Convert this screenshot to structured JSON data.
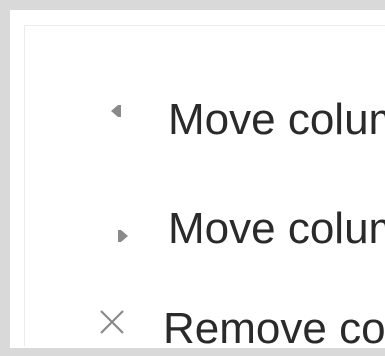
{
  "menu": {
    "items": [
      {
        "label": "Move colum",
        "icon": "move-left-icon"
      },
      {
        "label": "Move colum",
        "icon": "move-right-icon"
      },
      {
        "label": "Remove col",
        "icon": "close-icon"
      }
    ]
  },
  "colors": {
    "frame": "#d9d9d9",
    "text": "#2a2a2a",
    "icon": "#8a8a8a"
  }
}
